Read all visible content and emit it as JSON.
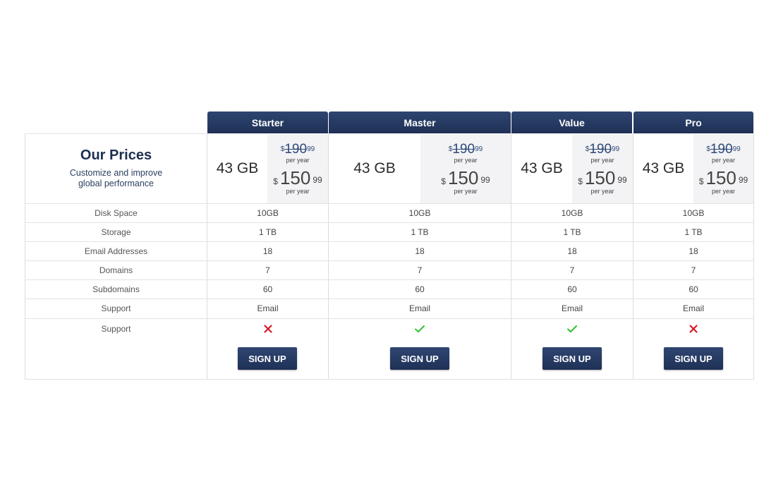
{
  "intro": {
    "title": "Our Prices",
    "subtitle_line1": "Customize and improve",
    "subtitle_line2": "global performance"
  },
  "plans": [
    {
      "name": "Starter",
      "storage": "43 GB",
      "old_price": {
        "currency": "$",
        "whole": "190",
        "cents": "99"
      },
      "new_price": {
        "currency": "$",
        "whole": "150",
        "cents": "99"
      },
      "period": "per year",
      "features": [
        "10GB",
        "1 TB",
        "18",
        "7",
        "60",
        "Email"
      ],
      "support_included": false,
      "button": "SIGN UP"
    },
    {
      "name": "Master",
      "storage": "43 GB",
      "old_price": {
        "currency": "$",
        "whole": "190",
        "cents": "99"
      },
      "new_price": {
        "currency": "$",
        "whole": "150",
        "cents": "99"
      },
      "period": "per year",
      "features": [
        "10GB",
        "1 TB",
        "18",
        "7",
        "60",
        "Email"
      ],
      "support_included": true,
      "button": "SIGN UP"
    },
    {
      "name": "Value",
      "storage": "43 GB",
      "old_price": {
        "currency": "$",
        "whole": "190",
        "cents": "99"
      },
      "new_price": {
        "currency": "$",
        "whole": "150",
        "cents": "99"
      },
      "period": "per year",
      "features": [
        "10GB",
        "1 TB",
        "18",
        "7",
        "60",
        "Email"
      ],
      "support_included": true,
      "button": "SIGN UP"
    },
    {
      "name": "Pro",
      "storage": "43 GB",
      "old_price": {
        "currency": "$",
        "whole": "190",
        "cents": "99"
      },
      "new_price": {
        "currency": "$",
        "whole": "150",
        "cents": "99"
      },
      "period": "per year",
      "features": [
        "10GB",
        "1 TB",
        "18",
        "7",
        "60",
        "Email"
      ],
      "support_included": false,
      "button": "SIGN UP"
    }
  ],
  "feature_labels": [
    "Disk Space",
    "Storage",
    "Email Addresses",
    "Domains",
    "Subdomains",
    "Support"
  ],
  "icon_row_label": "Support",
  "icons": {
    "included": "check-icon",
    "excluded": "x-icon"
  },
  "colors": {
    "header_bg": "#24375f",
    "button_bg": "#24375f",
    "check": "#2ec02e",
    "cross": "#d9182a",
    "price_box_bg": "#f3f3f5"
  }
}
